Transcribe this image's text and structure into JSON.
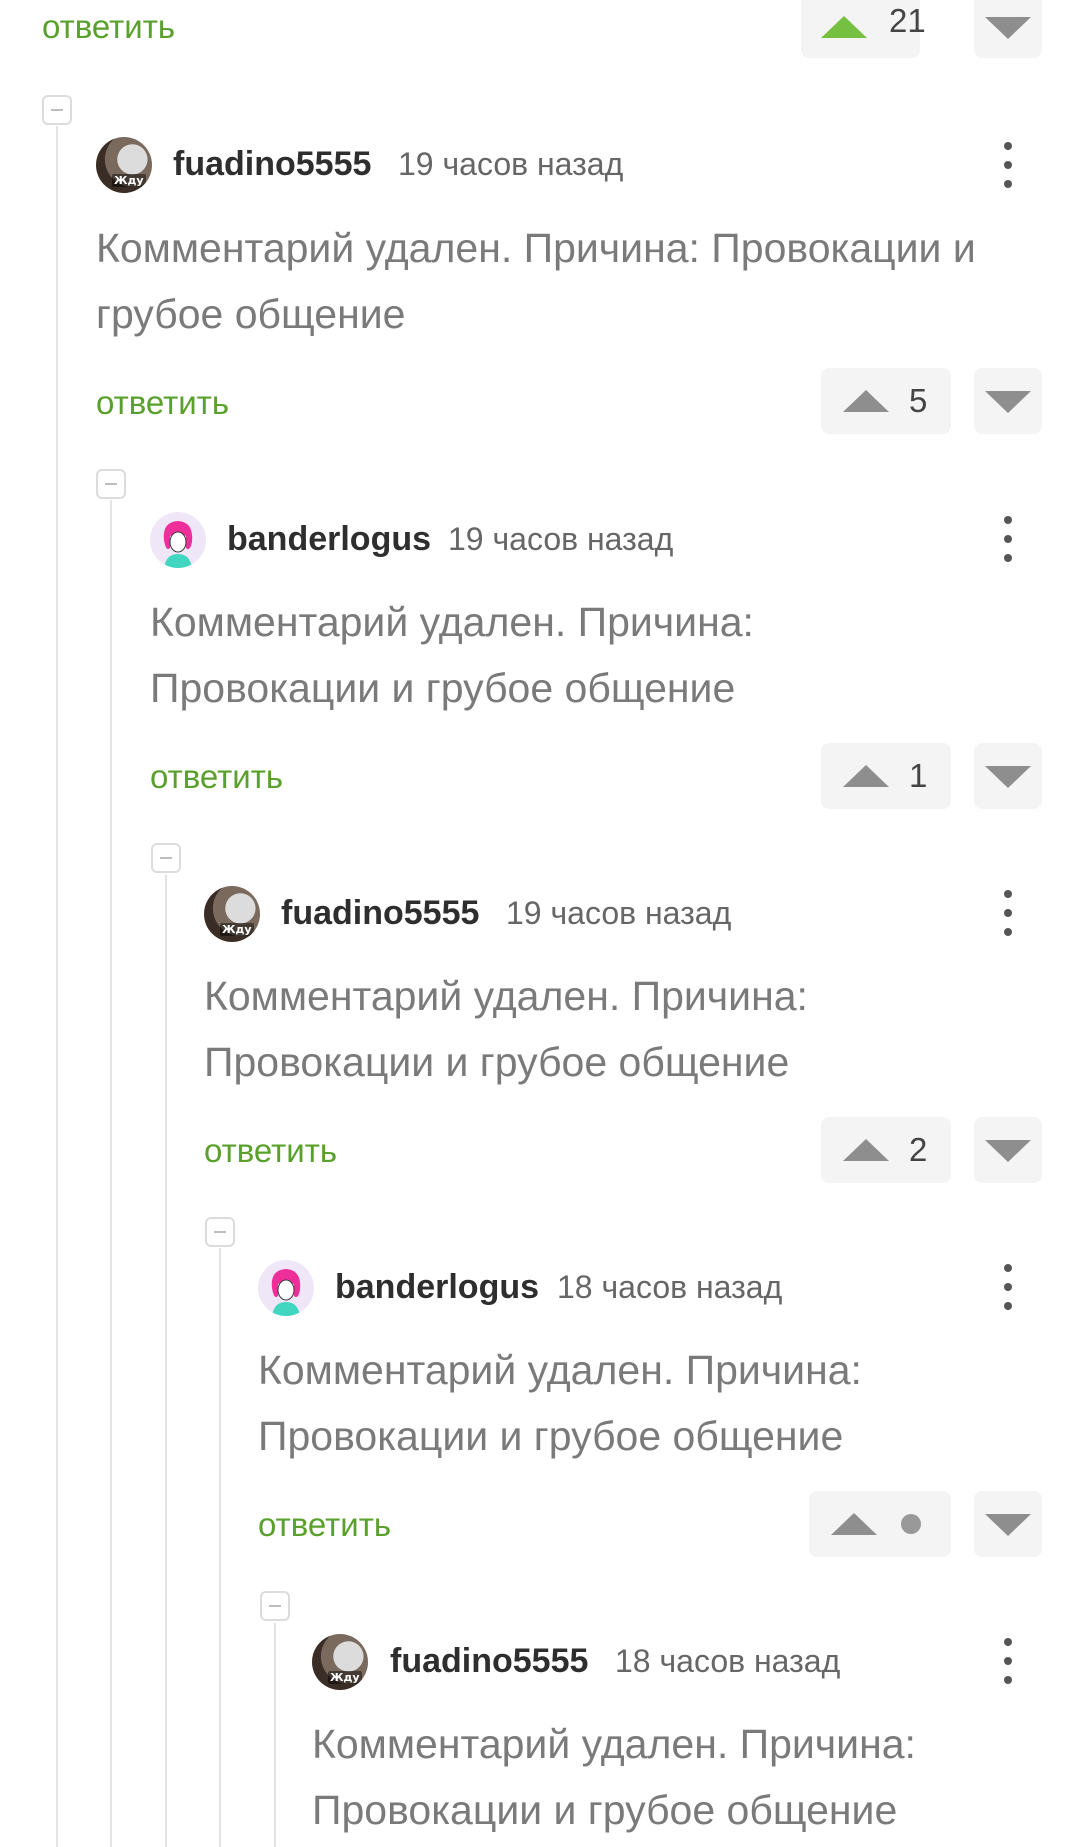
{
  "top": {
    "reply": "ответить",
    "score": "21"
  },
  "comments": [
    {
      "user": "fuadino5555",
      "time": "19 часов назад",
      "text": "Комментарий удален. Причина: Провокации и грубое общение",
      "reply": "ответить",
      "score": "5",
      "avatar_tag": "Жду"
    },
    {
      "user": "banderlogus",
      "time": "19 часов назад",
      "text": "Комментарий удален. Причина: Провокации и грубое общение",
      "reply": "ответить",
      "score": "1"
    },
    {
      "user": "fuadino5555",
      "time": "19 часов назад",
      "text": "Комментарий удален. Причина: Провокации и грубое общение",
      "reply": "ответить",
      "score": "2",
      "avatar_tag": "Жду"
    },
    {
      "user": "banderlogus",
      "time": "18 часов назад",
      "text": "Комментарий удален. Причина: Провокации и грубое общение",
      "reply": "ответить",
      "score": ""
    },
    {
      "user": "fuadino5555",
      "time": "18 часов назад",
      "text": "Комментарий удален. Причина: Провокации и грубое общение",
      "avatar_tag": "Жду"
    }
  ],
  "colors": {
    "reply": "#5aa02c",
    "upvote_active": "#75c040",
    "vote_bg": "#f4f4f4"
  },
  "icons": {
    "collapse": "minus-square-icon",
    "menu": "more-vertical-icon",
    "upvote": "triangle-up-icon",
    "downvote": "triangle-down-icon",
    "neutral": "dot-icon"
  }
}
